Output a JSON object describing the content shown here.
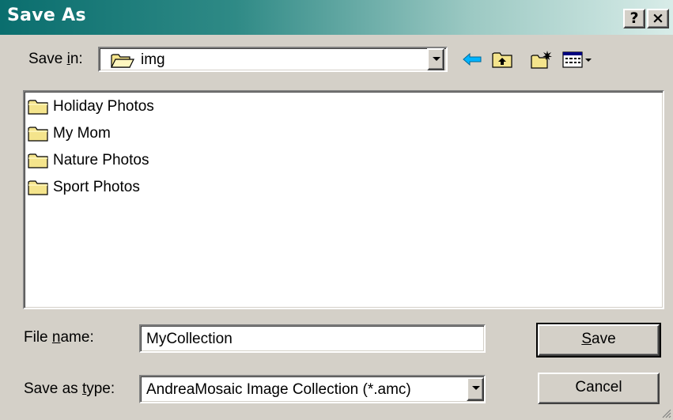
{
  "window": {
    "title": "Save As",
    "help_label": "?",
    "close_label": "×"
  },
  "save_in": {
    "label_pre": "Save ",
    "label_key": "i",
    "label_post": "n:",
    "value": "img"
  },
  "toolbar": {
    "buttons": [
      "back-icon",
      "up-one-level-icon",
      "create-new-folder-icon",
      "view-menu-icon"
    ]
  },
  "file_list": {
    "items": [
      {
        "name": "Holiday Photos",
        "icon": "folder-icon"
      },
      {
        "name": "My Mom",
        "icon": "folder-icon"
      },
      {
        "name": "Nature Photos",
        "icon": "folder-icon"
      },
      {
        "name": "Sport Photos",
        "icon": "folder-icon"
      }
    ]
  },
  "file_name": {
    "label_pre": "File ",
    "label_key": "n",
    "label_post": "ame:",
    "value": "MyCollection"
  },
  "save_as_type": {
    "label_pre": "Save as ",
    "label_key": "t",
    "label_post": "ype:",
    "value": "AndreaMosaic Image Collection (*.amc)"
  },
  "buttons": {
    "save_key": "S",
    "save_rest": "ave",
    "cancel": "Cancel"
  },
  "colors": {
    "face": "#d4d0c8",
    "title_start": "#0a6e6e",
    "title_end": "#d8ece8",
    "folder": "#f4e48c"
  }
}
